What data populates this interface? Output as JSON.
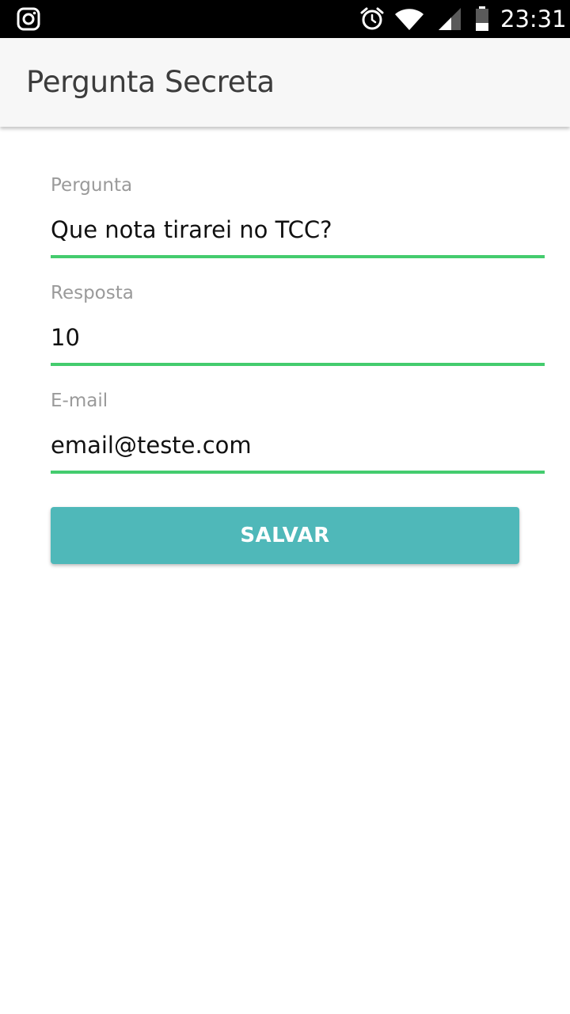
{
  "status_bar": {
    "time": "23:31",
    "icons": [
      "instagram-icon",
      "alarm-icon",
      "wifi-icon",
      "signal-icon",
      "battery-icon"
    ]
  },
  "app_bar": {
    "title": "Pergunta Secreta"
  },
  "form": {
    "fields": [
      {
        "label": "Pergunta",
        "value": "Que nota tirarei no TCC?"
      },
      {
        "label": "Resposta",
        "value": "10"
      },
      {
        "label": "E-mail",
        "value": "email@teste.com"
      }
    ],
    "save_label": "SALVAR"
  },
  "colors": {
    "status_bar_bg": "#000000",
    "app_bar_bg": "#f7f7f7",
    "underline_active": "#44cc6e",
    "button_bg": "#4fb8b9",
    "label_text": "#9a9a9a"
  }
}
